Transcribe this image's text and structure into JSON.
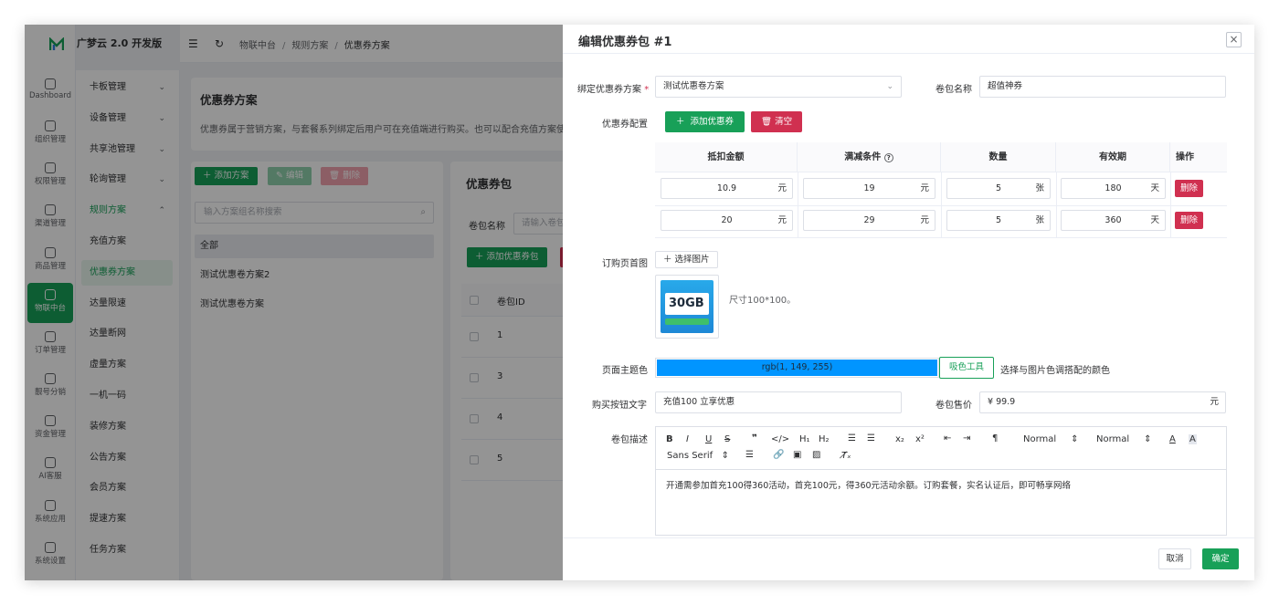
{
  "app": {
    "name": "广梦云 2.0 开发版"
  },
  "rail": [
    {
      "label": "Dashboard",
      "icon": "dashboard-icon"
    },
    {
      "label": "组织管理",
      "icon": "org-icon"
    },
    {
      "label": "权限管理",
      "icon": "permission-icon"
    },
    {
      "label": "渠道管理",
      "icon": "channel-icon"
    },
    {
      "label": "商品管理",
      "icon": "product-icon"
    },
    {
      "label": "物联中台",
      "icon": "iot-icon"
    },
    {
      "label": "订单管理",
      "icon": "order-icon"
    },
    {
      "label": "靓号分销",
      "icon": "number-icon"
    },
    {
      "label": "资金管理",
      "icon": "fund-icon"
    },
    {
      "label": "AI客服",
      "icon": "ai-service-icon"
    },
    {
      "label": "系统应用",
      "icon": "system-app-icon"
    },
    {
      "label": "系统设置",
      "icon": "settings-icon"
    }
  ],
  "submenu": [
    {
      "label": "卡板管理",
      "chevron": "⌄"
    },
    {
      "label": "设备管理",
      "chevron": "⌄"
    },
    {
      "label": "共享池管理",
      "chevron": "⌄"
    },
    {
      "label": "轮询管理",
      "chevron": "⌄"
    },
    {
      "label": "规则方案",
      "chevron": "⌃"
    },
    {
      "label": "充值方案",
      "chevron": ""
    },
    {
      "label": "优惠券方案",
      "chevron": ""
    },
    {
      "label": "达量限速",
      "chevron": ""
    },
    {
      "label": "达量断网",
      "chevron": ""
    },
    {
      "label": "虚量方案",
      "chevron": ""
    },
    {
      "label": "一机一码",
      "chevron": ""
    },
    {
      "label": "装修方案",
      "chevron": ""
    },
    {
      "label": "公告方案",
      "chevron": ""
    },
    {
      "label": "会员方案",
      "chevron": ""
    },
    {
      "label": "提速方案",
      "chevron": ""
    },
    {
      "label": "任务方案",
      "chevron": ""
    }
  ],
  "breadcrumb": [
    "物联中台",
    "规则方案",
    "优惠券方案"
  ],
  "page": {
    "title": "优惠券方案",
    "desc": "优惠券属于营销方案，与套餐系列绑定后用户可在充值端进行购买。也可以配合充值方案使用"
  },
  "left_panel": {
    "add": "添加方案",
    "edit": "编辑",
    "delete": "删除",
    "search_placeholder": "输入方案组名称搜索",
    "items": [
      "全部",
      "测试优惠卷方案2",
      "测试优惠卷方案"
    ]
  },
  "right_panel": {
    "title": "优惠券包",
    "filter_label": "卷包名称",
    "filter_placeholder": "请输入卷包名称",
    "add": "添加优惠券包",
    "col_id": "卷包ID",
    "ids": [
      "1",
      "3",
      "4",
      "5"
    ]
  },
  "drawer": {
    "title": "编辑优惠券包 #1",
    "bind_label": "绑定优惠券方案",
    "bind_value": "测试优惠卷方案",
    "name_label": "卷包名称",
    "name_value": "超值神券",
    "config_label": "优惠券配置",
    "add_coupon": "添加优惠券",
    "clear": "清空",
    "table_headers": [
      "抵扣金额",
      "满减条件",
      "数量",
      "有效期",
      "操作"
    ],
    "rows": [
      {
        "amount": "10.9",
        "amount_unit": "元",
        "cond": "19",
        "cond_unit": "元",
        "qty": "5",
        "qty_unit": "张",
        "days": "180",
        "days_unit": "天",
        "action": "删除"
      },
      {
        "amount": "20",
        "amount_unit": "元",
        "cond": "29",
        "cond_unit": "元",
        "qty": "5",
        "qty_unit": "张",
        "days": "360",
        "days_unit": "天",
        "action": "删除"
      }
    ],
    "image_label": "订购页首图",
    "pick_image": "选择图片",
    "thumb_text": "30GB",
    "size_hint": "尺寸100*100。",
    "theme_label": "页面主题色",
    "theme_value": "rgb(1, 149, 255)",
    "theme_color": "#0195ff",
    "picker": "吸色工具",
    "picker_hint": "选择与图片色调搭配的颜色",
    "button_text_label": "购买按钮文字",
    "button_text_value": "充值100 立享优惠",
    "price_label": "卷包售价",
    "price_prefix": "¥",
    "price_value": "99.9",
    "price_unit": "元",
    "desc_label": "卷包描述",
    "toolbar": {
      "normal1": "Normal",
      "normal2": "Normal",
      "font": "Sans Serif"
    },
    "desc_value": "开通需参加首充100得360活动，首充100元，得360元活动余额。订购套餐，实名认证后，即可畅享网络",
    "cancel": "取消",
    "confirm": "确定"
  },
  "colors": {
    "accent": "#18a058",
    "danger": "#d03050"
  }
}
